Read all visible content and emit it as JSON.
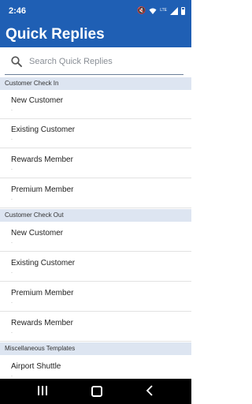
{
  "status_bar": {
    "time": "2:46",
    "network": "LTE"
  },
  "header": {
    "title": "Quick Replies"
  },
  "search": {
    "placeholder": "Search Quick Replies"
  },
  "sections": [
    {
      "title": "Customer Check In",
      "items": [
        {
          "label": "New Customer",
          "sub": "."
        },
        {
          "label": "Existing Customer",
          "sub": "."
        },
        {
          "label": "Rewards Member",
          "sub": "."
        },
        {
          "label": "Premium Member",
          "sub": "."
        }
      ]
    },
    {
      "title": "Customer Check Out",
      "items": [
        {
          "label": "New Customer",
          "sub": "."
        },
        {
          "label": "Existing Customer",
          "sub": "."
        },
        {
          "label": "Premium Member",
          "sub": "."
        },
        {
          "label": "Rewards Member",
          "sub": "."
        }
      ]
    },
    {
      "title": "Miscellaneous Templates",
      "items": [
        {
          "label": "Airport Shuttle",
          "sub": "."
        }
      ]
    }
  ],
  "colors": {
    "accent": "#1f5fb4",
    "section_bg": "#dde5f1"
  }
}
